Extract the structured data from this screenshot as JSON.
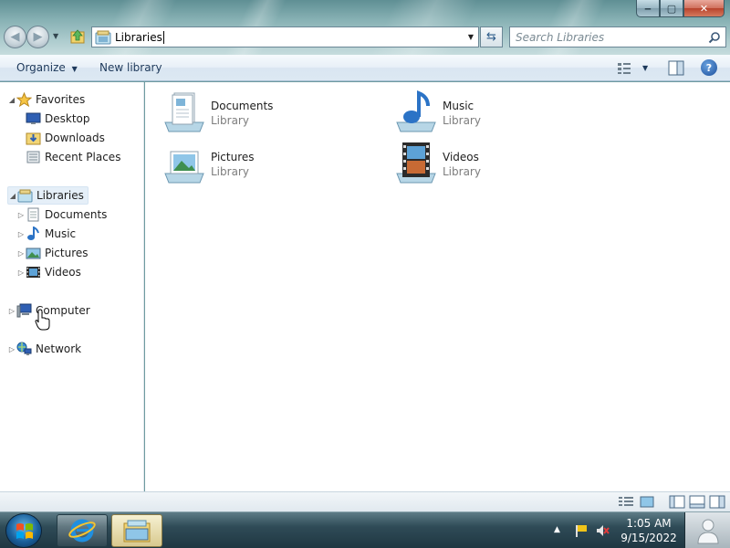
{
  "window": {
    "caption": {
      "minimize": "‒",
      "maximize": "▢",
      "close": "✕"
    }
  },
  "navigation": {
    "address_text": "Libraries",
    "search_placeholder": "Search Libraries"
  },
  "command_bar": {
    "organize": "Organize",
    "new_library": "New library",
    "help": "?"
  },
  "nav_pane": {
    "favorites": {
      "label": "Favorites",
      "items": [
        {
          "label": "Desktop",
          "icon": "desktop-icon"
        },
        {
          "label": "Downloads",
          "icon": "downloads-folder-icon"
        },
        {
          "label": "Recent Places",
          "icon": "recent-places-icon"
        }
      ]
    },
    "libraries": {
      "label": "Libraries",
      "items": [
        {
          "label": "Documents",
          "icon": "documents-icon"
        },
        {
          "label": "Music",
          "icon": "music-icon"
        },
        {
          "label": "Pictures",
          "icon": "pictures-icon"
        },
        {
          "label": "Videos",
          "icon": "videos-icon"
        }
      ]
    },
    "computer": "Computer",
    "network": "Network"
  },
  "content": {
    "libraries": [
      {
        "name": "Documents",
        "type": "Library",
        "icon": "documents-library-icon"
      },
      {
        "name": "Music",
        "type": "Library",
        "icon": "music-library-icon"
      },
      {
        "name": "Pictures",
        "type": "Library",
        "icon": "pictures-library-icon"
      },
      {
        "name": "Videos",
        "type": "Library",
        "icon": "videos-library-icon"
      }
    ]
  },
  "taskbar": {
    "clock_time": "1:05 AM",
    "clock_date": "9/15/2022"
  }
}
